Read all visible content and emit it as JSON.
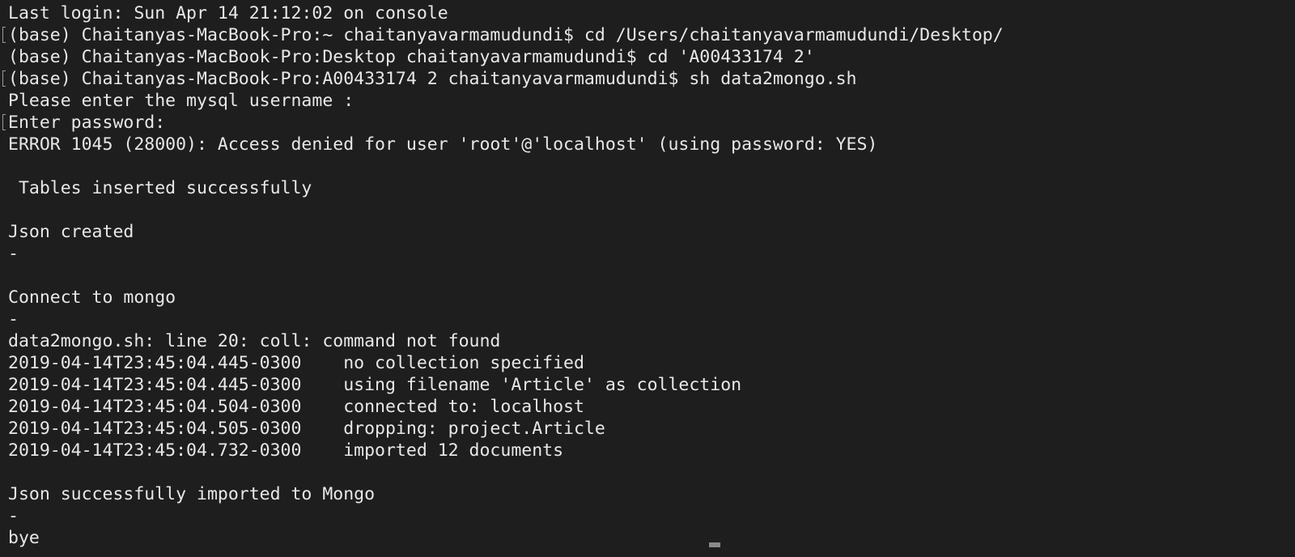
{
  "terminal": {
    "lines": [
      {
        "text": "Last login: Sun Apr 14 21:12:02 on console",
        "marked": false
      },
      {
        "text": "(base) Chaitanyas-MacBook-Pro:~ chaitanyavarmamudundi$ cd /Users/chaitanyavarmamudundi/Desktop/",
        "marked": true
      },
      {
        "text": "(base) Chaitanyas-MacBook-Pro:Desktop chaitanyavarmamudundi$ cd 'A00433174 2'",
        "marked": false
      },
      {
        "text": "(base) Chaitanyas-MacBook-Pro:A00433174 2 chaitanyavarmamudundi$ sh data2mongo.sh",
        "marked": true
      },
      {
        "text": "Please enter the mysql username :",
        "marked": false
      },
      {
        "text": "Enter password:",
        "marked": true
      },
      {
        "text": "ERROR 1045 (28000): Access denied for user 'root'@'localhost' (using password: YES)",
        "marked": false
      },
      {
        "text": "",
        "marked": false
      },
      {
        "text": " Tables inserted successfully",
        "marked": false
      },
      {
        "text": "",
        "marked": false
      },
      {
        "text": "Json created",
        "marked": false
      },
      {
        "text": "-",
        "marked": false
      },
      {
        "text": "",
        "marked": false
      },
      {
        "text": "Connect to mongo",
        "marked": false
      },
      {
        "text": "-",
        "marked": false
      },
      {
        "text": "data2mongo.sh: line 20: coll: command not found",
        "marked": false
      },
      {
        "text": "2019-04-14T23:45:04.445-0300    no collection specified",
        "marked": false
      },
      {
        "text": "2019-04-14T23:45:04.445-0300    using filename 'Article' as collection",
        "marked": false
      },
      {
        "text": "2019-04-14T23:45:04.504-0300    connected to: localhost",
        "marked": false
      },
      {
        "text": "2019-04-14T23:45:04.505-0300    dropping: project.Article",
        "marked": false
      },
      {
        "text": "2019-04-14T23:45:04.732-0300    imported 12 documents",
        "marked": false
      },
      {
        "text": "",
        "marked": false
      },
      {
        "text": "Json successfully imported to Mongo",
        "marked": false
      },
      {
        "text": "-",
        "marked": false
      },
      {
        "text": "bye",
        "marked": false
      }
    ]
  },
  "colors": {
    "background": "#1e1e1e",
    "foreground": "#e8e8e8",
    "mark": "#9a9a9a",
    "scroll_thumb": "#8a8a8a"
  }
}
